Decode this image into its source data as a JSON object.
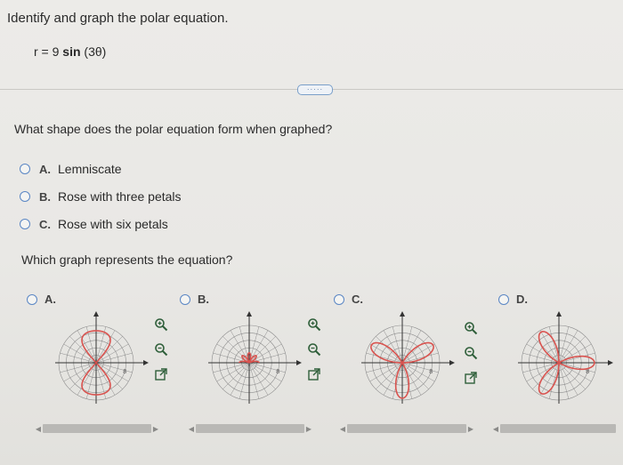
{
  "problem": {
    "title": "Identify and graph the polar equation.",
    "equation_prefix": "r = 9",
    "equation_func": "sin",
    "equation_arg": "(3θ)"
  },
  "more_button": "·····",
  "question1": {
    "text": "What shape does the polar equation form when graphed?",
    "options": [
      {
        "letter": "A.",
        "text": "Lemniscate"
      },
      {
        "letter": "B.",
        "text": "Rose with three petals"
      },
      {
        "letter": "C.",
        "text": "Rose with six petals"
      }
    ]
  },
  "question2": {
    "text": "Which graph represents the equation?",
    "options": [
      {
        "letter": "A.",
        "shape": "figure-eight"
      },
      {
        "letter": "B.",
        "shape": "small-star"
      },
      {
        "letter": "C.",
        "shape": "three-petal-rose-upright"
      },
      {
        "letter": "D.",
        "shape": "three-petal-rose-rotated"
      }
    ]
  },
  "graph_labels": {
    "tick": "8"
  },
  "colors": {
    "curve": "#d9534f",
    "accent": "#5a86c4",
    "grid": "#8d8d8d"
  },
  "tools": [
    "zoom-in-icon",
    "zoom-out-icon",
    "external-link-icon"
  ]
}
